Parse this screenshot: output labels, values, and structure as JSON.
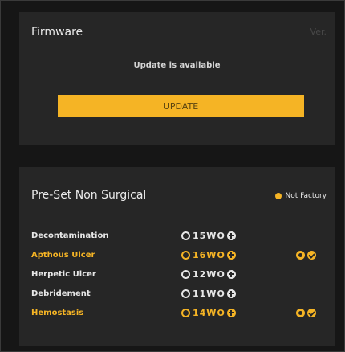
{
  "firmware": {
    "title": "Firmware",
    "version_label": "Ver.",
    "status": "Update is available",
    "update_button": "UPDATE"
  },
  "preset": {
    "title": "Pre-Set Non Surgical",
    "badge": "Not Factory",
    "badge_color": "#f5b425",
    "rows": [
      {
        "name": "Decontamination",
        "cycle": "15WO",
        "highlight": false,
        "status_icons": []
      },
      {
        "name": "Apthous Ulcer",
        "cycle": "16WO",
        "highlight": true,
        "status_icons": [
          "radio-icon",
          "check-icon"
        ]
      },
      {
        "name": "Herpetic Ulcer",
        "cycle": "12WO",
        "highlight": false,
        "status_icons": []
      },
      {
        "name": "Debridement",
        "cycle": "11WO",
        "highlight": false,
        "status_icons": []
      },
      {
        "name": "Hemostasis",
        "cycle": "14WO",
        "highlight": true,
        "status_icons": [
          "radio-icon",
          "check-icon"
        ]
      }
    ]
  },
  "colors": {
    "accent": "#f5b425",
    "panel": "#262626",
    "background": "#161616"
  }
}
